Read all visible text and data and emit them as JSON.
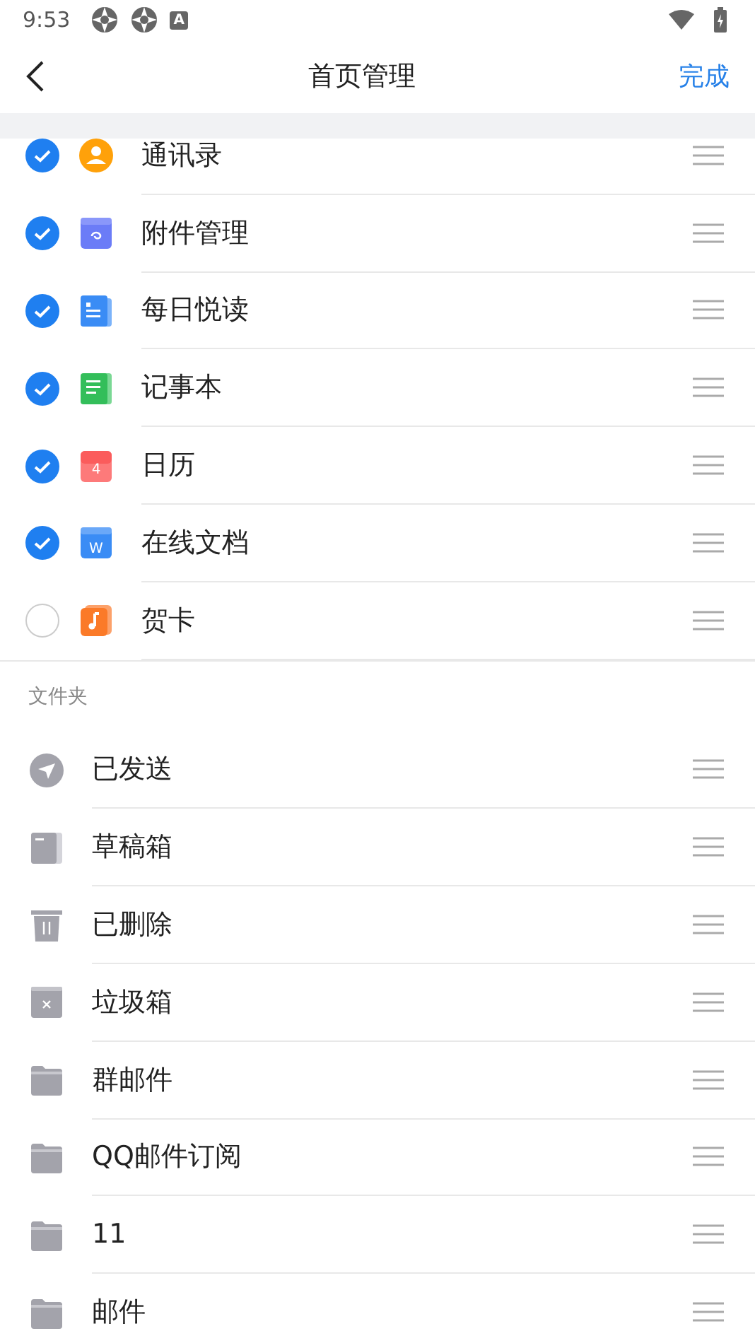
{
  "status_bar": {
    "time": "9:53",
    "badge_letter": "A"
  },
  "header": {
    "title": "首页管理",
    "done": "完成"
  },
  "apps": [
    {
      "label": "通讯录",
      "kind": "contacts",
      "checked": true
    },
    {
      "label": "附件管理",
      "kind": "attachment",
      "checked": true
    },
    {
      "label": "每日悦读",
      "kind": "reading",
      "checked": true
    },
    {
      "label": "记事本",
      "kind": "notes",
      "checked": true
    },
    {
      "label": "日历",
      "kind": "calendar",
      "checked": true,
      "icon_text": "4"
    },
    {
      "label": "在线文档",
      "kind": "document",
      "checked": true,
      "icon_text": "W"
    },
    {
      "label": "贺卡",
      "kind": "card",
      "checked": false
    }
  ],
  "folders_heading": "文件夹",
  "folders": [
    {
      "label": "已发送",
      "kind": "sent"
    },
    {
      "label": "草稿箱",
      "kind": "drafts"
    },
    {
      "label": "已删除",
      "kind": "trash"
    },
    {
      "label": "垃圾箱",
      "kind": "spam"
    },
    {
      "label": "群邮件",
      "kind": "folder"
    },
    {
      "label": "QQ邮件订阅",
      "kind": "folder"
    },
    {
      "label": "11",
      "kind": "folder"
    },
    {
      "label": "邮件",
      "kind": "folder"
    }
  ]
}
